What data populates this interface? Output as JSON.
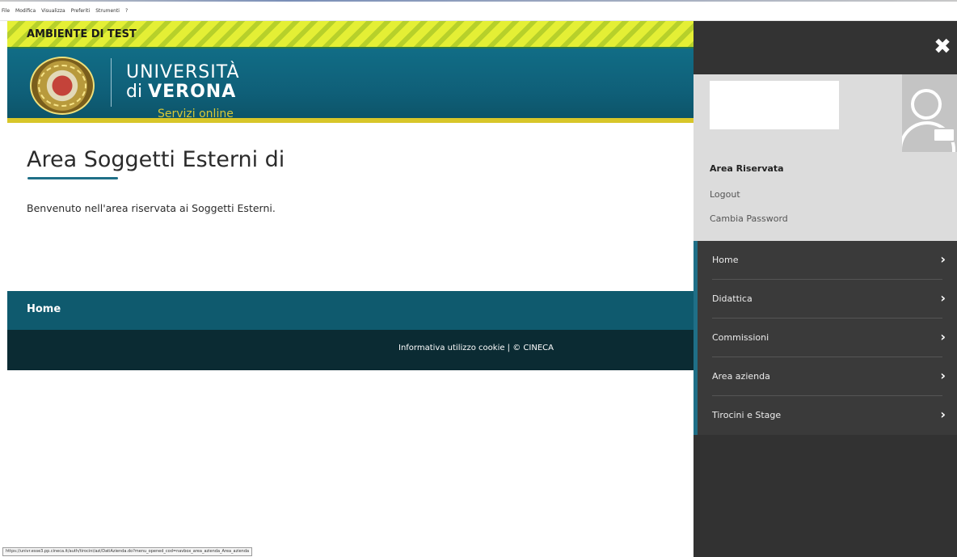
{
  "browser": {
    "menu": [
      "File",
      "Modifica",
      "Visualizza",
      "Preferiti",
      "Strumenti",
      "?"
    ],
    "status_url": "https://univr.esse3.pp.cineca.it/auth/tirocini/azi/DatiAzienda.do?menu_opened_cod=navbox_area_azienda_Area_azienda"
  },
  "banner": {
    "text": "AMBIENTE DI TEST"
  },
  "header": {
    "line1": "UNIVERSITÀ",
    "line2_prefix": "di ",
    "line2_bold": "VERONA",
    "tagline": "Servizi online"
  },
  "main": {
    "title": "Area Soggetti Esterni di",
    "welcome": "Benvenuto nell'area riservata ai Soggetti Esterni."
  },
  "footer": {
    "nav_home": "Home",
    "cookie_link": "Informativa utilizzo cookie",
    "separator": " | ",
    "copyright": "© CINECA"
  },
  "panel": {
    "close_glyph": "✖",
    "area_title": "Area Riservata",
    "logout": "Logout",
    "change_password": "Cambia Password",
    "menu": [
      {
        "label": "Home"
      },
      {
        "label": "Didattica"
      },
      {
        "label": "Commissioni"
      },
      {
        "label": "Area azienda"
      },
      {
        "label": "Tirocini e Stage"
      }
    ],
    "chevron": "›"
  },
  "colors": {
    "header_teal": "#116d86",
    "footer_teal": "#0f5a6e",
    "footer_dark": "#0b2b33",
    "panel_dark": "#323232",
    "accent_yellow": "#d8c629"
  },
  "icons": [
    "seal-icon",
    "close-icon",
    "avatar-icon",
    "chevron-right-icon"
  ]
}
